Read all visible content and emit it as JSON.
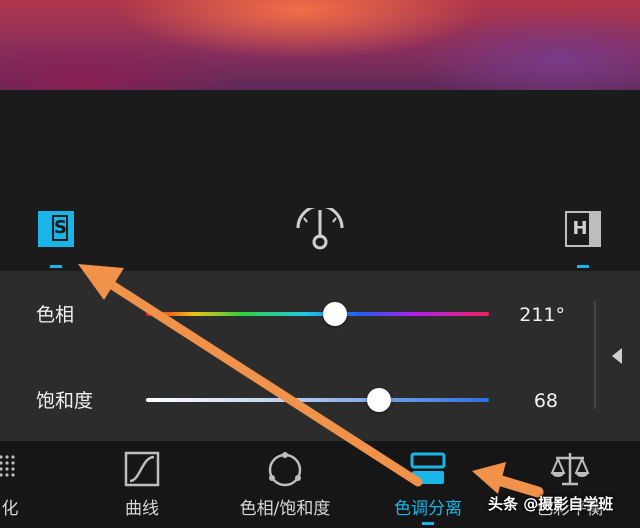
{
  "modes": {
    "shadows_label": "S",
    "highlights_label": "H",
    "center_icon": "balance-gauge-icon"
  },
  "sliders": [
    {
      "label": "色相",
      "value": "211°",
      "level": 0.55,
      "track": "hue-spectrum"
    },
    {
      "label": "饱和度",
      "value": "68",
      "level": 0.68,
      "track": "saturation-gradient"
    }
  ],
  "toolbar": {
    "items": [
      {
        "label": "化",
        "icon": "dots-grid-icon"
      },
      {
        "label": "曲线",
        "icon": "curve-icon"
      },
      {
        "label": "色相/饱和度",
        "icon": "hue-circle-icon"
      },
      {
        "label": "色调分离",
        "icon": "split-toning-icon",
        "active": true
      },
      {
        "label": "色彩平衡",
        "icon": "balance-scale-icon"
      }
    ]
  },
  "watermark": "头条 @摄影自学班",
  "colors": {
    "accent": "#19b4e8",
    "annotation_arrow": "#f0924a",
    "panel": "#2c2c2c",
    "background": "#1b1b1b"
  }
}
